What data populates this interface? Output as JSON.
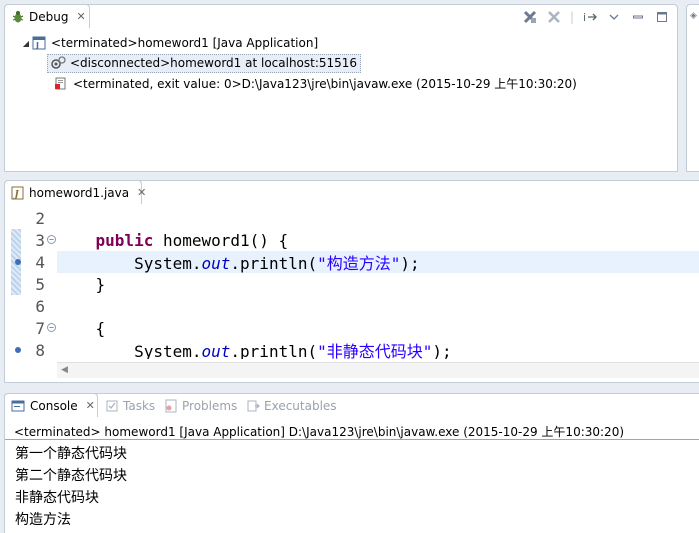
{
  "debug": {
    "tab_label": "Debug",
    "tree": [
      {
        "label": "<terminated>homeword1 [Java Application]"
      },
      {
        "label": "<disconnected>homeword1 at localhost:51516"
      },
      {
        "label": "<terminated, exit value: 0>D:\\Java123\\jre\\bin\\javaw.exe (2015-10-29 上午10:30:20)"
      }
    ]
  },
  "editor": {
    "tab_label": "homeword1.java",
    "lines": [
      {
        "num": "2",
        "segments": []
      },
      {
        "num": "3",
        "segments": [
          {
            "text": "    ",
            "cls": ""
          },
          {
            "text": "public",
            "cls": "kw"
          },
          {
            "text": " homeword1() {",
            "cls": ""
          }
        ]
      },
      {
        "num": "4",
        "segments": [
          {
            "text": "        System.",
            "cls": ""
          },
          {
            "text": "out",
            "cls": "fld"
          },
          {
            "text": ".println(",
            "cls": ""
          },
          {
            "text": "\"构造方法\"",
            "cls": "str"
          },
          {
            "text": ");",
            "cls": ""
          }
        ]
      },
      {
        "num": "5",
        "segments": [
          {
            "text": "    }",
            "cls": ""
          }
        ]
      },
      {
        "num": "6",
        "segments": []
      },
      {
        "num": "7",
        "segments": [
          {
            "text": "    {",
            "cls": ""
          }
        ]
      },
      {
        "num": "8",
        "segments": [
          {
            "text": "        System.",
            "cls": ""
          },
          {
            "text": "out",
            "cls": "fld"
          },
          {
            "text": ".println(",
            "cls": ""
          },
          {
            "text": "\"非静态代码块\"",
            "cls": "str"
          },
          {
            "text": ");",
            "cls": ""
          }
        ]
      }
    ]
  },
  "console": {
    "tabs": [
      "Console",
      "Tasks",
      "Problems",
      "Executables"
    ],
    "header": "<terminated> homeword1 [Java Application] D:\\Java123\\jre\\bin\\javaw.exe (2015-10-29 上午10:30:20)",
    "output": [
      "第一个静态代码块",
      "第二个静态代码块",
      "非静态代码块",
      "构造方法"
    ]
  },
  "colors": {
    "keyword": "#7f0055",
    "field": "#0000c0",
    "string": "#2a00ff",
    "current_line": "#e8f2fe"
  },
  "icons": {
    "debug_tab": "bug-icon",
    "tab_close": "close-icon",
    "toolbar": [
      "remove-all-terminated-icon",
      "remove-launch-icon",
      "step-filters-icon",
      "view-menu-icon",
      "minimize-icon",
      "maximize-icon"
    ],
    "tree": [
      "java-app-icon",
      "debug-target-icon",
      "process-terminated-icon"
    ],
    "editor_tab": "java-file-icon",
    "console_tabs": [
      "console-icon",
      "tasks-icon",
      "problems-icon",
      "executables-icon"
    ]
  }
}
